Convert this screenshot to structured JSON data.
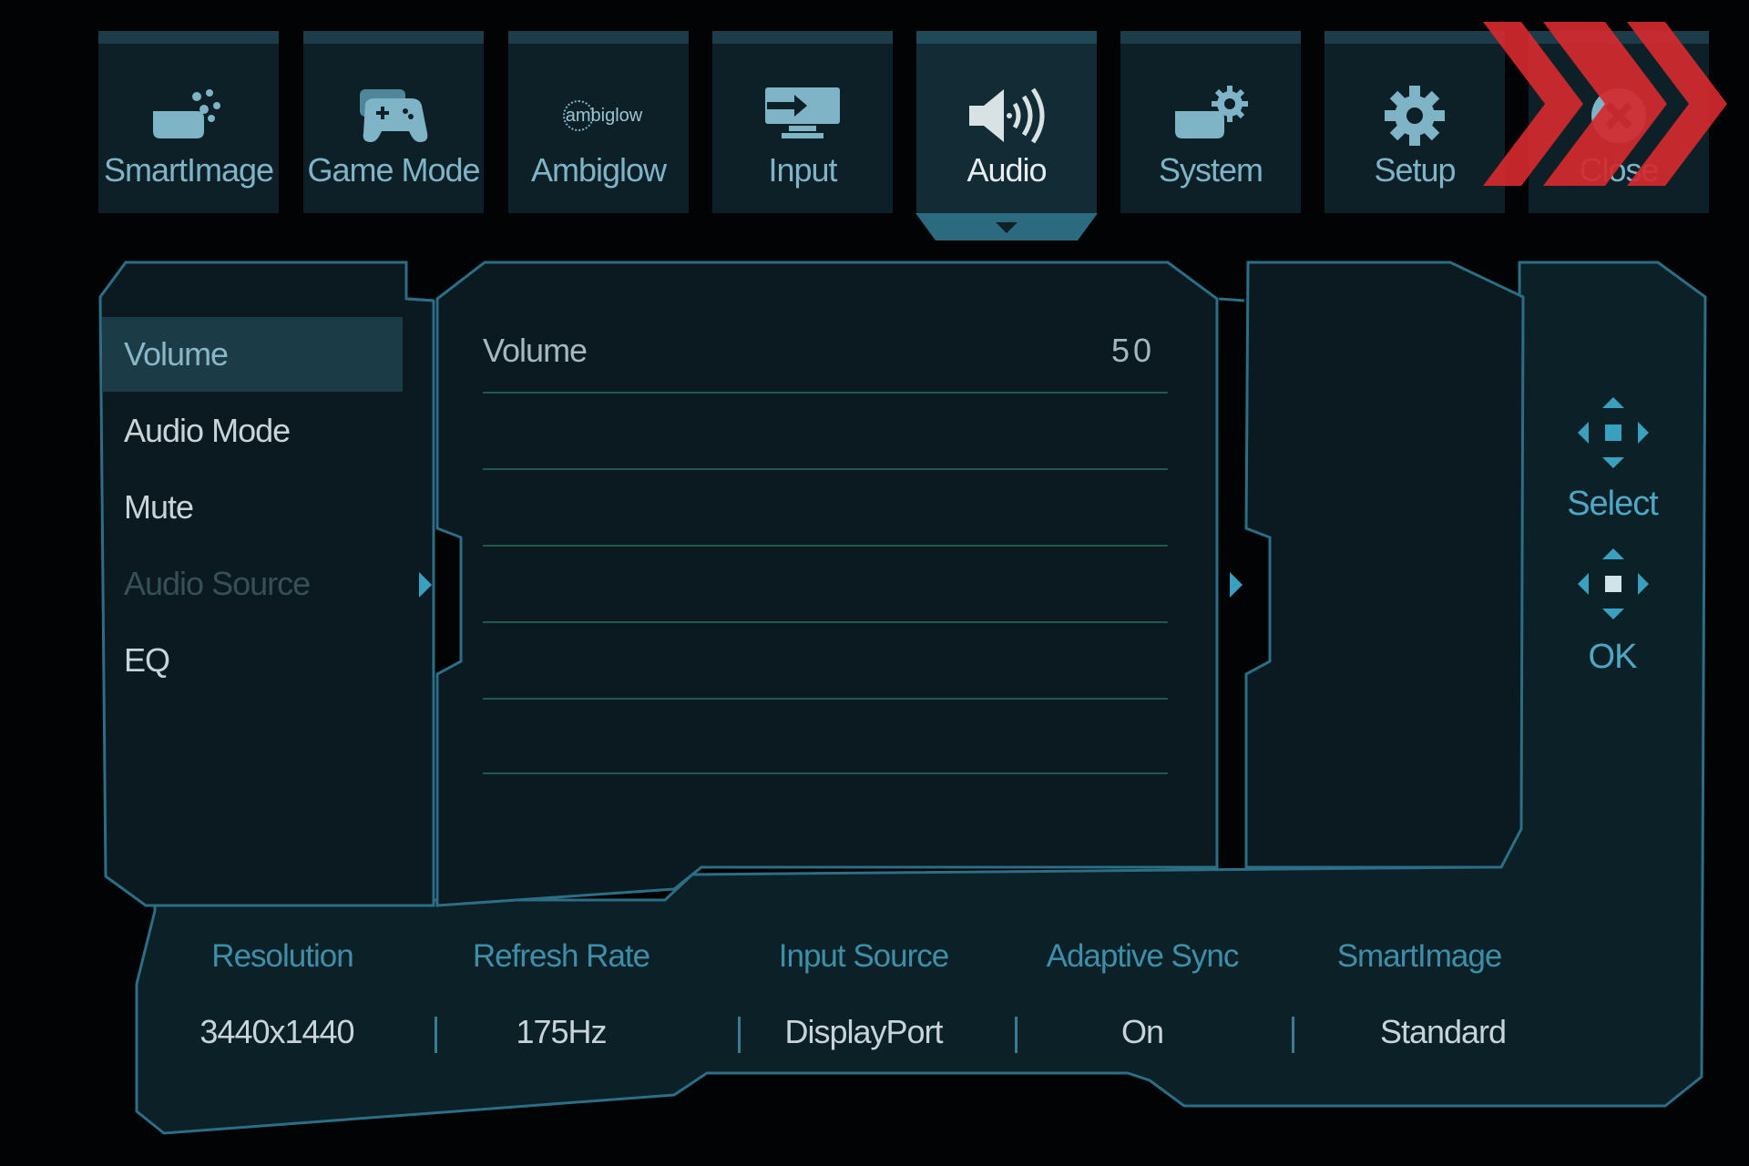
{
  "tabs": [
    {
      "label": "SmartImage",
      "icon": "smartimage-icon"
    },
    {
      "label": "Game Mode",
      "icon": "gamepad-icon"
    },
    {
      "label": "Ambiglow",
      "icon": "ambiglow-icon",
      "icon_text": "ambiglow"
    },
    {
      "label": "Input",
      "icon": "input-icon"
    },
    {
      "label": "Audio",
      "icon": "speaker-icon",
      "active": true
    },
    {
      "label": "System",
      "icon": "system-icon"
    },
    {
      "label": "Setup",
      "icon": "gear-icon"
    },
    {
      "label": "Close",
      "icon": "close-icon"
    }
  ],
  "menu": {
    "items": [
      {
        "label": "Volume",
        "state": "selected"
      },
      {
        "label": "Audio Mode",
        "state": "normal"
      },
      {
        "label": "Mute",
        "state": "normal"
      },
      {
        "label": "Audio Source",
        "state": "disabled"
      },
      {
        "label": "EQ",
        "state": "normal"
      }
    ]
  },
  "detail": {
    "label": "Volume",
    "value": "50"
  },
  "hints": {
    "select": "Select",
    "ok": "OK"
  },
  "status": {
    "headers": [
      "Resolution",
      "Refresh Rate",
      "Input Source",
      "Adaptive Sync",
      "SmartImage"
    ],
    "values": [
      "3440x1440",
      "175Hz",
      "DisplayPort",
      "On",
      "Standard"
    ]
  },
  "colors": {
    "accent": "#3aa0bf",
    "panel_border": "#2b6e86",
    "selected_bg": "#1b3c47",
    "watermark": "#d42a2e"
  }
}
